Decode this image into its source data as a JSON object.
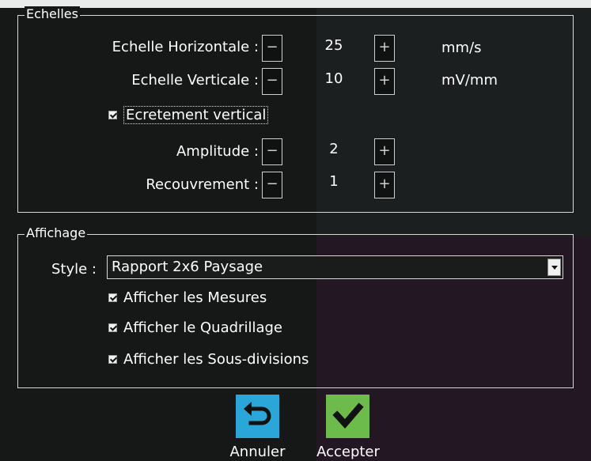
{
  "echelles": {
    "title": "Echelles",
    "horizontal": {
      "label": "Echelle Horizontale :",
      "minus": "−",
      "value": "25",
      "plus": "+",
      "unit": "mm/s"
    },
    "vertical": {
      "label": "Echelle Verticale :",
      "minus": "−",
      "value": "10",
      "plus": "+",
      "unit": "mV/mm"
    },
    "ecretement": {
      "label": "Ecretement vertical",
      "checked": true
    },
    "amplitude": {
      "label": "Amplitude :",
      "minus": "−",
      "value": "2",
      "plus": "+"
    },
    "recouvrement": {
      "label": "Recouvrement :",
      "minus": "−",
      "value": "1",
      "plus": "+"
    }
  },
  "affichage": {
    "title": "Affichage",
    "style_label": "Style :",
    "style_value": "Rapport 2x6 Paysage",
    "options": [
      {
        "label": "Afficher les Mesures",
        "checked": true
      },
      {
        "label": "Afficher le Quadrillage",
        "checked": true
      },
      {
        "label": "Afficher les Sous-divisions",
        "checked": true
      }
    ]
  },
  "actions": {
    "cancel_label": "Annuler",
    "accept_label": "Accepter",
    "cancel_icon": "undo-icon",
    "accept_icon": "checkmark-icon",
    "cancel_color": "#2aa7d8",
    "accept_color": "#6dbb4b"
  }
}
